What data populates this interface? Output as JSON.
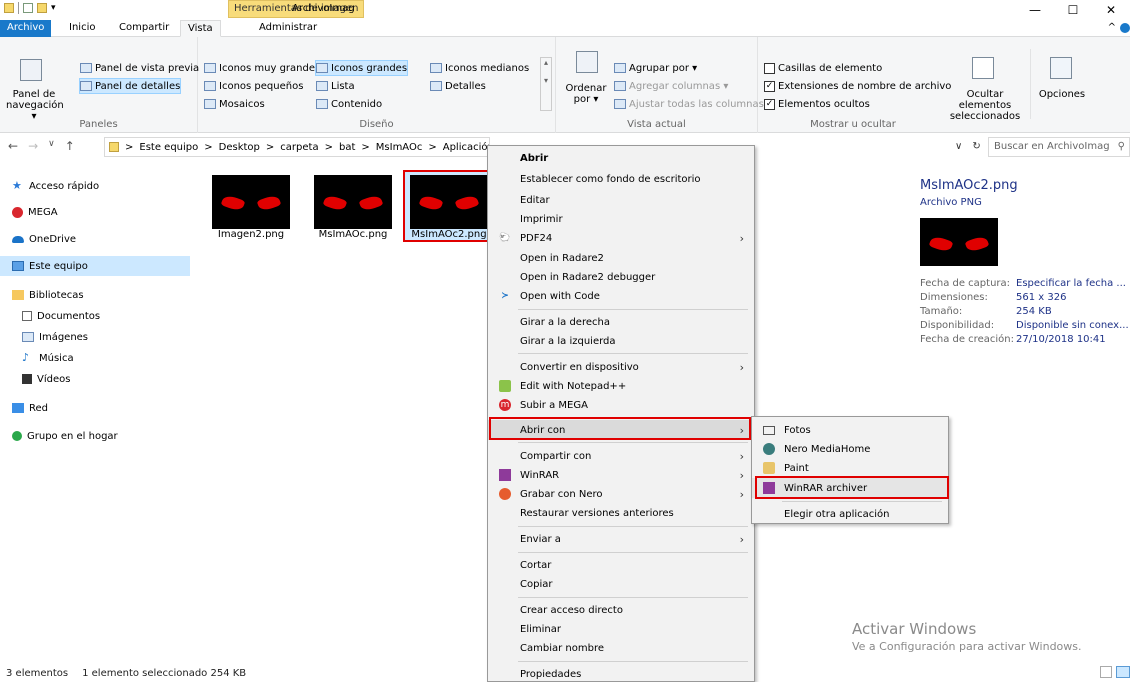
{
  "title_bar": {
    "contextual_tab": "Herramientas de imagen",
    "window_title": "ArchivoImag",
    "controls": [
      "—",
      "☐",
      "✕"
    ]
  },
  "ribbon_tabs": {
    "file": "Archivo",
    "home": "Inicio",
    "share": "Compartir",
    "view": "Vista",
    "manage": "Administrar"
  },
  "ribbon": {
    "panes": {
      "nav_pane": "Panel de navegación ▾",
      "preview_pane": "Panel de vista previa",
      "details_pane": "Panel de detalles",
      "label": "Paneles"
    },
    "layout": {
      "very_large": "Iconos muy grandes",
      "large": "Iconos grandes",
      "medium": "Iconos medianos",
      "small": "Iconos pequeños",
      "list": "Lista",
      "details": "Detalles",
      "tiles": "Mosaicos",
      "content": "Contenido",
      "label": "Diseño"
    },
    "current_view": {
      "sort_by": "Ordenar por ▾",
      "group_by": "Agrupar por ▾",
      "add_columns": "Agregar columnas ▾",
      "fit_columns": "Ajustar todas las columnas",
      "label": "Vista actual"
    },
    "show_hide": {
      "item_checkboxes": "Casillas de elemento",
      "file_extensions": "Extensiones de nombre de archivo",
      "hidden_items": "Elementos ocultos",
      "hide_selected": "Ocultar elementos seleccionados",
      "options": "Opciones",
      "label": "Mostrar u ocultar",
      "item_checkboxes_checked": false,
      "file_extensions_checked": true,
      "hidden_items_checked": true
    }
  },
  "address": {
    "crumbs": [
      "Este equipo",
      "Desktop",
      "carpeta",
      "bat",
      "MsImAOc",
      "Aplicación"
    ],
    "separator": ">",
    "search_placeholder": "Buscar en ArchivoImag",
    "refresh_icon": "↻",
    "dropdown_icon": "∨"
  },
  "nav": {
    "items": [
      "Acceso rápido",
      "MEGA",
      "OneDrive",
      "Este equipo",
      "Bibliotecas",
      "Documentos",
      "Imágenes",
      "Música",
      "Vídeos",
      "Red",
      "Grupo en el hogar"
    ]
  },
  "files": [
    {
      "name": "Imagen2.png",
      "selected": false
    },
    {
      "name": "MsImAOc.png",
      "selected": false
    },
    {
      "name": "MsImAOc2.png",
      "selected": true
    }
  ],
  "details": {
    "filename": "MsImAOc2.png",
    "type": "Archivo PNG",
    "rows": [
      {
        "label": "Fecha de captura:",
        "value": "Especificar la fecha ..."
      },
      {
        "label": "Dimensiones:",
        "value": "561 x 326"
      },
      {
        "label": "Tamaño:",
        "value": "254 KB"
      },
      {
        "label": "Disponibilidad:",
        "value": "Disponible sin conex..."
      },
      {
        "label": "Fecha de creación:",
        "value": "27/10/2018 10:41"
      }
    ]
  },
  "context_menu": {
    "items": [
      "Abrir",
      "Establecer como fondo de escritorio",
      "Editar",
      "Imprimir",
      "PDF24",
      "Open in Radare2",
      "Open in Radare2 debugger",
      "Open with Code",
      "Girar a la derecha",
      "Girar a la izquierda",
      "Convertir en dispositivo",
      "Edit with Notepad++",
      "Subir a MEGA",
      "Abrir con",
      "Compartir con",
      "WinRAR",
      "Grabar con Nero",
      "Restaurar versiones anteriores",
      "Enviar a",
      "Cortar",
      "Copiar",
      "Crear acceso directo",
      "Eliminar",
      "Cambiar nombre",
      "Propiedades"
    ],
    "highlighted": "Abrir con"
  },
  "submenu": {
    "items": [
      "Fotos",
      "Nero MediaHome",
      "Paint",
      "WinRAR archiver",
      "Elegir otra aplicación"
    ],
    "highlighted": "WinRAR archiver"
  },
  "status": {
    "count": "3 elementos",
    "selection": "1 elemento seleccionado  254 KB"
  },
  "watermark": {
    "line1": "Activar Windows",
    "line2": "Ve a Configuración para activar Windows."
  },
  "colors": {
    "accent": "#1979ca",
    "highlight_border": "#e00000",
    "context_tab": "#f8dc7b"
  }
}
